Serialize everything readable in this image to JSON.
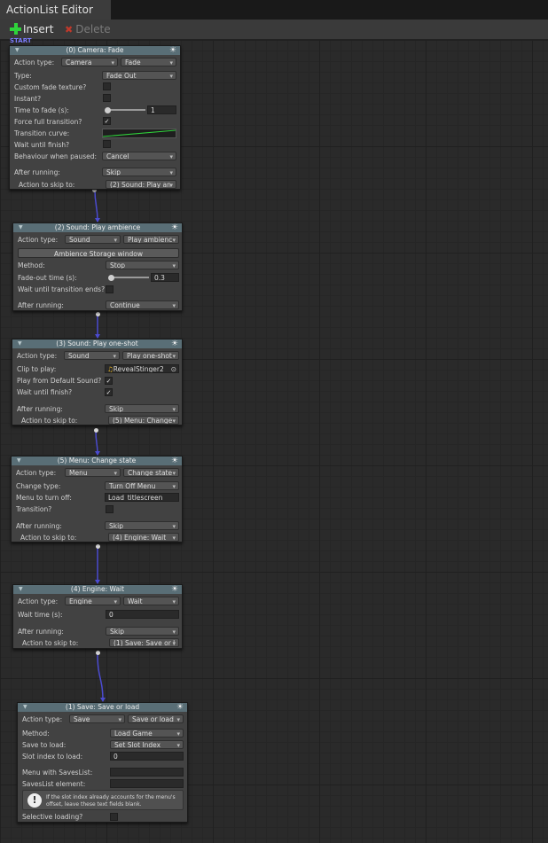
{
  "window": {
    "tab_title": "ActionList Editor"
  },
  "toolbar": {
    "insert_label": "Insert",
    "delete_label": "Delete"
  },
  "canvas": {
    "start_label": "START"
  },
  "nodes": {
    "fade": {
      "title": "(0) Camera: Fade",
      "action_type_label": "Action type:",
      "category": "Camera",
      "action": "Fade",
      "type_label": "Type:",
      "type_value": "Fade Out",
      "custom_texture_label": "Custom fade texture?",
      "instant_label": "Instant?",
      "time_label": "Time to fade (s):",
      "time_value": "1",
      "force_full_label": "Force full transition?",
      "force_full_checked": "✓",
      "curve_label": "Transition curve:",
      "wait_label": "Wait until finish?",
      "behaviour_label": "Behaviour when paused:",
      "behaviour_value": "Cancel",
      "after_label": "After running:",
      "after_value": "Skip",
      "skip_label": "Action to skip to:",
      "skip_value": "(2) Sound: Play an"
    },
    "ambience": {
      "title": "(2) Sound: Play ambience",
      "action_type_label": "Action type:",
      "category": "Sound",
      "action": "Play ambienc",
      "storage_button": "Ambience Storage window",
      "method_label": "Method:",
      "method_value": "Stop",
      "fadeout_label": "Fade-out time (s):",
      "fadeout_value": "0.3",
      "wait_label": "Wait until transition ends?",
      "after_label": "After running:",
      "after_value": "Continue"
    },
    "oneshot": {
      "title": "(3) Sound: Play one-shot",
      "action_type_label": "Action type:",
      "category": "Sound",
      "action": "Play one-shot",
      "clip_label": "Clip to play:",
      "clip_value": "RevealStinger2_",
      "default_label": "Play from Default Sound?",
      "default_checked": "✓",
      "wait_label": "Wait until finish?",
      "wait_checked": "✓",
      "after_label": "After running:",
      "after_value": "Skip",
      "skip_label": "Action to skip to:",
      "skip_value": "(5) Menu: Change"
    },
    "menu": {
      "title": "(5) Menu: Change state",
      "action_type_label": "Action type:",
      "category": "Menu",
      "action": "Change state",
      "change_label": "Change type:",
      "change_value": "Turn Off Menu",
      "menu_label": "Menu to turn off:",
      "menu_value": "Load_titlescreen",
      "transition_label": "Transition?",
      "after_label": "After running:",
      "after_value": "Skip",
      "skip_label": "Action to skip to:",
      "skip_value": "(4) Engine: Wait"
    },
    "wait": {
      "title": "(4) Engine: Wait",
      "action_type_label": "Action type:",
      "category": "Engine",
      "action": "Wait",
      "time_label": "Wait time (s):",
      "time_value": "0",
      "after_label": "After running:",
      "after_value": "Skip",
      "skip_label": "Action to skip to:",
      "skip_value": "(1) Save: Save or l"
    },
    "save": {
      "title": "(1) Save: Save or load",
      "action_type_label": "Action type:",
      "category": "Save",
      "action": "Save or load",
      "method_label": "Method:",
      "method_value": "Load Game",
      "saveto_label": "Save to load:",
      "saveto_value": "Set Slot Index",
      "slot_label": "Slot index to load:",
      "slot_value": "0",
      "menu_label": "Menu with SavesList:",
      "element_label": "SavesList element:",
      "help_text": "If the slot index already accounts for the menu's offset, leave these text fields blank.",
      "selective_label": "Selective loading?"
    }
  }
}
